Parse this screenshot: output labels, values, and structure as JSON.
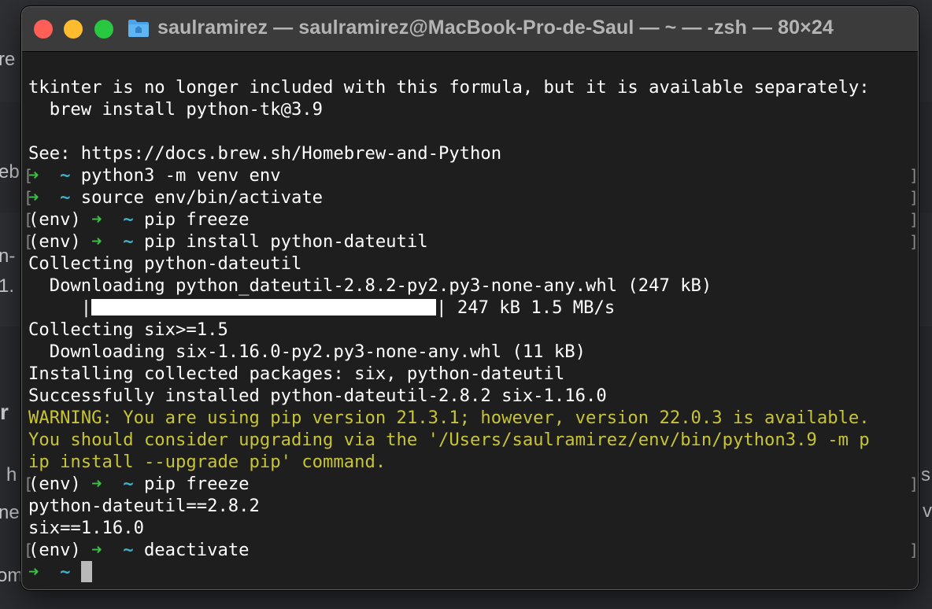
{
  "background_fragments": [
    "re",
    "eb",
    "n-",
    "1.",
    "r",
    "h",
    "ne",
    "om",
    "s",
    "v"
  ],
  "window": {
    "title": "saulramirez — saulramirez@MacBook-Pro-de-Saul — ~ — -zsh — 80×24",
    "folder_icon": "folder-icon"
  },
  "colors": {
    "background": "#1e1e1e",
    "text": "#ffffff",
    "warning": "#c7c435",
    "prompt_arrow": "#3fbb4a",
    "prompt_tilde": "#3fb2c8"
  },
  "terminal": {
    "l1": "tkinter is no longer included with this formula, but it is available separately:",
    "l2": "  brew install python-tk@3.9",
    "l4": "See: https://docs.brew.sh/Homebrew-and-Python",
    "arrow": "➜",
    "tilde": "~",
    "env": "(env)",
    "cmd1": "python3 -m venv env",
    "cmd2": "source env/bin/activate",
    "cmd3": "pip freeze",
    "cmd4": "pip install python-dateutil",
    "l9": "Collecting python-dateutil",
    "l10": "  Downloading python_dateutil-2.8.2-py2.py3-none-any.whl (247 kB)",
    "progress_prefix": "     |",
    "progress_fraction": 1.0,
    "progress_suffix": "| 247 kB 1.5 MB/s",
    "l12": "Collecting six>=1.5",
    "l13": "  Downloading six-1.16.0-py2.py3-none-any.whl (11 kB)",
    "l14": "Installing collected packages: six, python-dateutil",
    "l15": "Successfully installed python-dateutil-2.8.2 six-1.16.0",
    "w1": "WARNING: You are using pip version 21.3.1; however, version 22.0.3 is available.",
    "w2": "You should consider upgrading via the '/Users/saulramirez/env/bin/python3.9 -m p",
    "w3": "ip install --upgrade pip' command.",
    "cmd5": "pip freeze",
    "o1": "python-dateutil==2.8.2",
    "o2": "six==1.16.0",
    "cmd6": "deactivate"
  }
}
